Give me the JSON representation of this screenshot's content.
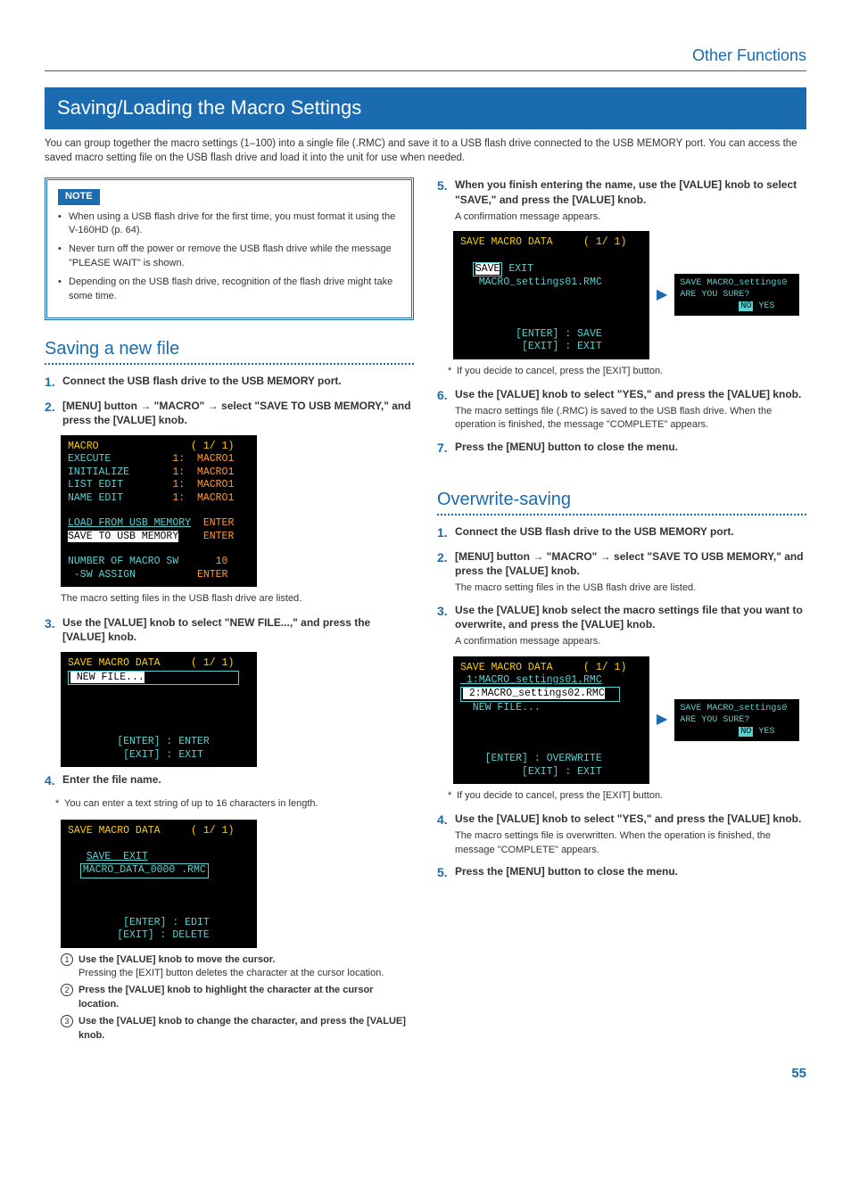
{
  "header": {
    "category": "Other Functions"
  },
  "title": "Saving/Loading the Macro Settings",
  "intro": "You can group together the macro settings (1–100) into a single file (.RMC) and save it to a USB flash drive connected to the USB MEMORY port. You can access the saved macro setting file on the USB flash drive and load it into the unit for use when needed.",
  "note": {
    "label": "NOTE",
    "items": [
      "When using a USB flash drive for the first time, you must format it using the V-160HD (p. 64).",
      "Never turn off the power or remove the USB flash drive while the message \"PLEASE WAIT\" is shown.",
      "Depending on the USB flash drive, recognition of the flash drive might take some time."
    ]
  },
  "saving": {
    "title": "Saving a new file",
    "step1": "Connect the USB flash drive to the USB MEMORY port.",
    "step2": "[MENU] button → \"MACRO\" → select \"SAVE TO USB MEMORY,\" and press the [VALUE] knob.",
    "lcd1": {
      "l1a": "MACRO",
      "l1b": "( 1/ 1)",
      "l2a": "EXECUTE",
      "l2b": "1:  MACRO1",
      "l3a": "INITIALIZE",
      "l3b": "1:  MACRO1",
      "l4a": "LIST EDIT",
      "l4b": "1:  MACRO1",
      "l5a": "NAME EDIT",
      "l5b": "1:  MACRO1",
      "l6a": "LOAD FROM USB MEMORY",
      "l6b": "ENTER",
      "l7a": "SAVE TO USB MEMORY",
      "l7b": "ENTER",
      "l8a": "NUMBER OF MACRO SW",
      "l8b": "10",
      "l9a": " -SW ASSIGN",
      "l9b": "ENTER"
    },
    "after_lcd1": "The macro setting files in the USB flash drive are listed.",
    "step3": "Use the [VALUE] knob to select \"NEW FILE...,\" and press the [VALUE] knob.",
    "lcd2": {
      "l1a": "SAVE MACRO DATA",
      "l1b": "( 1/ 1)",
      "l2": " NEW FILE...",
      "ft1": "[ENTER] : ENTER",
      "ft2": "[EXIT] : EXIT"
    },
    "step4": "Enter the file name.",
    "step4_note": "You can enter a text string of up to 16 characters in length.",
    "lcd3": {
      "l1a": "SAVE MACRO DATA",
      "l1b": "( 1/ 1)",
      "l2": "SAVE  EXIT",
      "l3": "MACRO_DATA_0000 .RMC",
      "ft1": "[ENTER] : EDIT",
      "ft2": "[EXIT] : DELETE"
    },
    "sub1_bold": "Use the [VALUE] knob to move the cursor.",
    "sub1_text": "Pressing the [EXIT] button deletes the character at the cursor location.",
    "sub2_bold": "Press the [VALUE] knob to highlight the character at the cursor location.",
    "sub3_bold": "Use the [VALUE] knob to change the character, and press the [VALUE] knob.",
    "step5": "When you finish entering the name, use the [VALUE] knob to select \"SAVE,\" and press the [VALUE] knob.",
    "step5_note": "A confirmation message appears.",
    "lcd4": {
      "l1a": "SAVE MACRO DATA",
      "l1b": "( 1/ 1)",
      "l2a": "SAVE",
      "l2b": "EXIT",
      "l3": "MACRO_settings01.RMC",
      "ft1": "[ENTER] : SAVE",
      "ft2": "[EXIT] : EXIT"
    },
    "confirm1": {
      "l1": "SAVE MACRO_settings0",
      "l2": "ARE YOU SURE?",
      "no": "NO",
      "yes": "YES"
    },
    "cancel_note": "If you decide to cancel, press the [EXIT] button.",
    "step6": "Use the [VALUE] knob to select \"YES,\" and press the [VALUE] knob.",
    "step6_note": "The macro settings file (.RMC) is saved to the USB flash drive. When the operation is finished, the message \"COMPLETE\" appears.",
    "step7": "Press the [MENU] button to close the menu."
  },
  "overwrite": {
    "title": "Overwrite-saving",
    "step1": "Connect the USB flash drive to the USB MEMORY port.",
    "step2": "[MENU] button → \"MACRO\" → select \"SAVE TO USB MEMORY,\" and press the [VALUE] knob.",
    "step2_note": "The macro setting files in the USB flash drive are listed.",
    "step3": "Use the [VALUE] knob select the macro settings file that you want to overwrite, and press the [VALUE] knob.",
    "step3_note": "A confirmation message appears.",
    "lcd1": {
      "l1a": "SAVE MACRO DATA",
      "l1b": "( 1/ 1)",
      "l2": " 1:MACRO_settings01.RMC",
      "l3": " 2:MACRO_settings02.RMC",
      "l4": "  NEW FILE...",
      "ft1": "[ENTER] : OVERWRITE",
      "ft2": "[EXIT] : EXIT"
    },
    "confirm1": {
      "l1": "SAVE MACRO_settings0",
      "l2": "ARE YOU SURE?",
      "no": "NO",
      "yes": "YES"
    },
    "cancel_note": "If you decide to cancel, press the [EXIT] button.",
    "step4": "Use the [VALUE] knob to select \"YES,\" and press the [VALUE] knob.",
    "step4_note": "The macro settings file is overwritten. When the operation is finished, the message \"COMPLETE\" appears.",
    "step5": "Press the [MENU] button to close the menu."
  },
  "pagenum": "55"
}
